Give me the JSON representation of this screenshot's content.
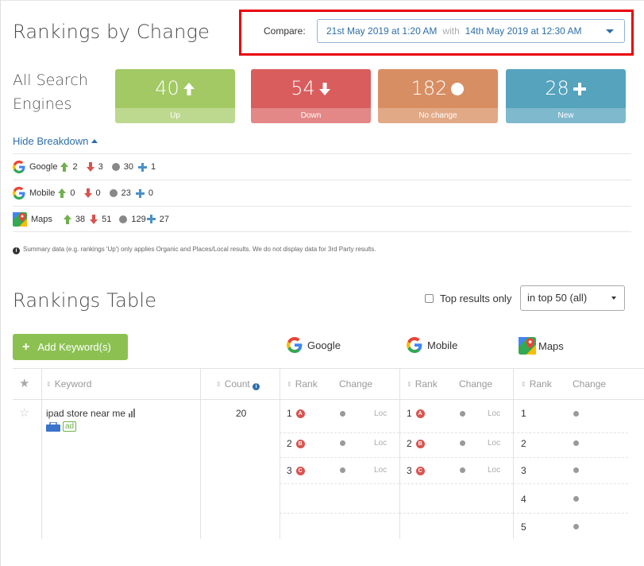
{
  "header": {
    "title": "Rankings by Change",
    "compare_label": "Compare:",
    "compare_from": "21st May 2019 at 1:20 AM",
    "compare_with": "with",
    "compare_to": "14th May 2019 at 12:30 AM"
  },
  "summary": {
    "label": "All Search Engines",
    "up": {
      "value": "40",
      "label": "Up",
      "color": "#a2c964"
    },
    "down": {
      "value": "54",
      "label": "Down",
      "color": "#d95d5d"
    },
    "nochange": {
      "value": "182",
      "label": "No change",
      "color": "#d88e63"
    },
    "new": {
      "value": "28",
      "label": "New",
      "color": "#55a3bd"
    }
  },
  "breakdown": {
    "toggle_label": "Hide Breakdown",
    "rows": [
      {
        "name": "Google",
        "up": "2",
        "down": "3",
        "same": "30",
        "new": "1"
      },
      {
        "name": "Mobile",
        "up": "0",
        "down": "0",
        "same": "23",
        "new": "0"
      },
      {
        "name": "Maps",
        "up": "38",
        "down": "51",
        "same": "129",
        "new": "27"
      }
    ],
    "note": "Summary data (e.g. rankings 'Up') only applies Organic and Places/Local results. We do not display data for 3rd Party results."
  },
  "table": {
    "title": "Rankings Table",
    "top_results_label": "Top results only",
    "topn_value": "in top 50 (all)",
    "add_keyword_label": "Add Keyword(s)",
    "engines": [
      "Google",
      "Mobile",
      "Maps"
    ],
    "headers": {
      "keyword": "Keyword",
      "count": "Count",
      "rank": "Rank",
      "change": "Change"
    },
    "row": {
      "keyword": "ipad store near me",
      "ad_badge": "ad",
      "count": "20",
      "google": [
        {
          "rank": "1",
          "pin": "A",
          "loc": "Loc"
        },
        {
          "rank": "2",
          "pin": "B",
          "loc": "Loc"
        },
        {
          "rank": "3",
          "pin": "C",
          "loc": "Loc"
        }
      ],
      "mobile": [
        {
          "rank": "1",
          "pin": "A",
          "loc": "Loc"
        },
        {
          "rank": "2",
          "pin": "B",
          "loc": "Loc"
        },
        {
          "rank": "3",
          "pin": "C",
          "loc": "Loc"
        }
      ],
      "maps": [
        {
          "rank": "1"
        },
        {
          "rank": "2"
        },
        {
          "rank": "3"
        },
        {
          "rank": "4"
        },
        {
          "rank": "5"
        }
      ]
    }
  }
}
